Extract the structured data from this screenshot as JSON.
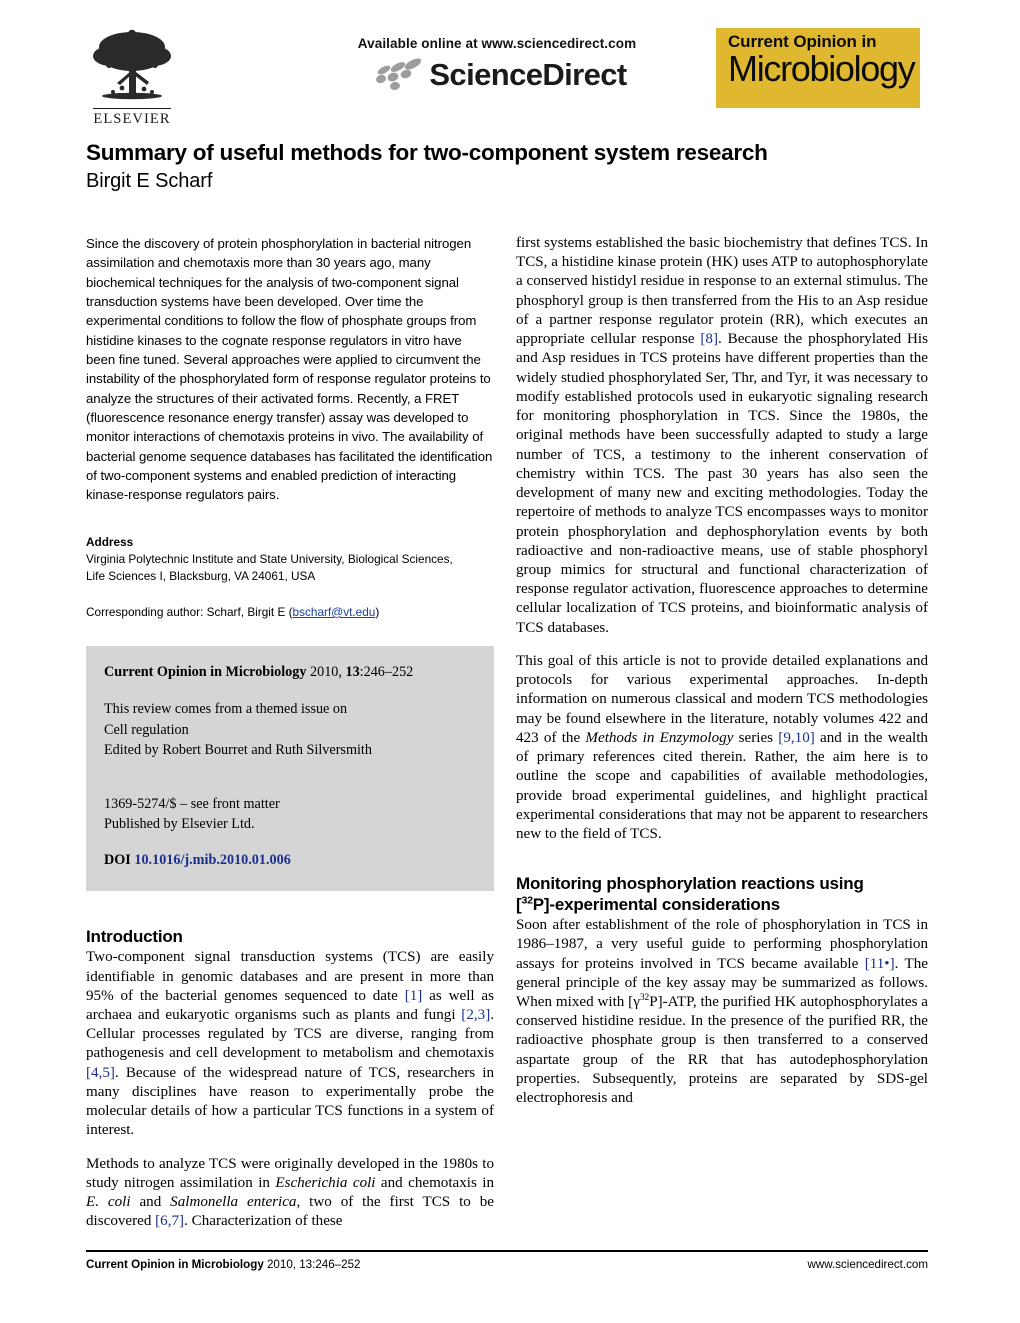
{
  "masthead": {
    "publisher_name": "ELSEVIER",
    "publisher_icon": "elsevier-tree-logo",
    "available_online": "Available online at www.sciencedirect.com",
    "sciencedirect_word": "ScienceDirect",
    "sciencedirect_icon": "sciencedirect-swoosh-icon",
    "journal_badge_line1": "Current Opinion in",
    "journal_badge_line2": "Microbiology",
    "journal_badge_color": "#e0b830"
  },
  "title": {
    "article_title": "Summary of useful methods for two-component system research",
    "author": "Birgit E Scharf"
  },
  "abstract": {
    "text": "Since the discovery of protein phosphorylation in bacterial nitrogen assimilation and chemotaxis more than 30 years ago, many biochemical techniques for the analysis of two-component signal transduction systems have been developed. Over time the experimental conditions to follow the flow of phosphate groups from histidine kinases to the cognate response regulators in vitro have been fine tuned. Several approaches were applied to circumvent the instability of the phosphorylated form of response regulator proteins to analyze the structures of their activated forms. Recently, a FRET (fluorescence resonance energy transfer) assay was developed to monitor interactions of chemotaxis proteins in vivo. The availability of bacterial genome sequence databases has facilitated the identification of two-component systems and enabled prediction of interacting kinase-response regulators pairs."
  },
  "address": {
    "heading": "Address",
    "line1": "Virginia Polytechnic Institute and State University, Biological Sciences,",
    "line2": "Life Sciences I, Blacksburg, VA 24061, USA",
    "corresponding_prefix": "Corresponding author: Scharf, Birgit E (",
    "corresponding_email": "bscharf@vt.edu",
    "corresponding_suffix": ")"
  },
  "citation_box": {
    "journal_name": "Current Opinion in Microbiology",
    "citation_rest": " 2010, ",
    "volume": "13",
    "pages": ":246–252",
    "themed_line1": "This review comes from a themed issue on",
    "themed_line2": "Cell regulation",
    "themed_line3": "Edited by Robert Bourret and Ruth Silversmith",
    "front_matter_line1": "1369-5274/$ – see front matter",
    "front_matter_line2": "Published by Elsevier Ltd.",
    "doi_label": "DOI",
    "doi_value": "10.1016/j.mib.2010.01.006",
    "background_color": "#d5d5d5",
    "link_color": "#1b2f8f"
  },
  "left_column": {
    "intro_heading": "Introduction",
    "intro_p1_a": "Two-component signal transduction systems (TCS) are easily identifiable in genomic databases and are present in more than 95% of the bacterial genomes sequenced to date ",
    "intro_p1_ref1": "[1]",
    "intro_p1_b": " as well as archaea and eukaryotic organisms such as plants and fungi ",
    "intro_p1_ref2": "[2,3]",
    "intro_p1_c": ". Cellular processes regulated by TCS are diverse, ranging from pathogenesis and cell development to metabolism and chemotaxis ",
    "intro_p1_ref3": "[4,5]",
    "intro_p1_d": ". Because of the widespread nature of TCS, researchers in many disciplines have reason to experimentally probe the molecular details of how a particular TCS functions in a system of interest.",
    "intro_p2_a": "Methods to analyze TCS were originally developed in the 1980s to study nitrogen assimilation in ",
    "intro_p2_i1": "Escherichia coli",
    "intro_p2_b": " and chemotaxis in ",
    "intro_p2_i2": "E. coli",
    "intro_p2_c": " and ",
    "intro_p2_i3": "Salmonella enterica",
    "intro_p2_d": ", two of the first TCS to be discovered ",
    "intro_p2_ref": "[6,7]",
    "intro_p2_e": ". Characterization of these"
  },
  "right_column": {
    "p1_a": "first systems established the basic biochemistry that defines TCS. In TCS, a histidine kinase protein (HK) uses ATP to autophosphorylate a conserved histidyl residue in response to an external stimulus. The phosphoryl group is then transferred from the His to an Asp residue of a partner response regulator protein (RR), which executes an appropriate cellular response ",
    "p1_ref": "[8]",
    "p1_b": ". Because the phosphorylated His and Asp residues in TCS proteins have different properties than the widely studied phosphorylated Ser, Thr, and Tyr, it was necessary to modify established protocols used in eukaryotic signaling research for monitoring phosphorylation in TCS. Since the 1980s, the original methods have been successfully adapted to study a large number of TCS, a testimony to the inherent conservation of chemistry within TCS. The past 30 years has also seen the development of many new and exciting methodologies. Today the repertoire of methods to analyze TCS encompasses ways to monitor protein phosphorylation and dephosphorylation events by both radioactive and non-radioactive means, use of stable phosphoryl group mimics for structural and functional characterization of response regulator activation, fluorescence approaches to determine cellular localization of TCS proteins, and bioinformatic analysis of TCS databases.",
    "p2_a": "This goal of this article is not to provide detailed explanations and protocols for various experimental approaches. In-depth information on numerous classical and modern TCS methodologies may be found elsewhere in the literature, notably volumes 422 and 423 of the ",
    "p2_i1": "Methods in Enzymology",
    "p2_b": " series ",
    "p2_ref": "[9,10]",
    "p2_c": " and in the wealth of primary references cited therein. Rather, the aim here is to outline the scope and capabilities of available methodologies, provide broad experimental guidelines, and highlight practical experimental considerations that may not be apparent to researchers new to the field of TCS.",
    "sec_head_line1": "Monitoring phosphorylation reactions using",
    "sec_head_pre": "[",
    "sec_head_sup": "32",
    "sec_head_post": "P]-experimental considerations",
    "p3_a": "Soon after establishment of the role of phosphorylation in TCS in 1986–1987, a very useful guide to performing phosphorylation assays for proteins involved in TCS became available ",
    "p3_ref": "[11•]",
    "p3_b": ". The general principle of the key assay may be summarized as follows. When mixed with [γ",
    "p3_sup": "32",
    "p3_c": "P]-ATP, the purified HK autophosphorylates a conserved histidine residue. In the presence of the purified RR, the radioactive phosphate group is then transferred to a conserved aspartate group of the RR that has autodephosphorylation properties. Subsequently, proteins are separated by SDS-gel electrophoresis and"
  },
  "footer": {
    "journal_bold": "Current Opinion in Microbiology",
    "journal_rest": " 2010, 13:246–252",
    "website": "www.sciencedirect.com"
  }
}
